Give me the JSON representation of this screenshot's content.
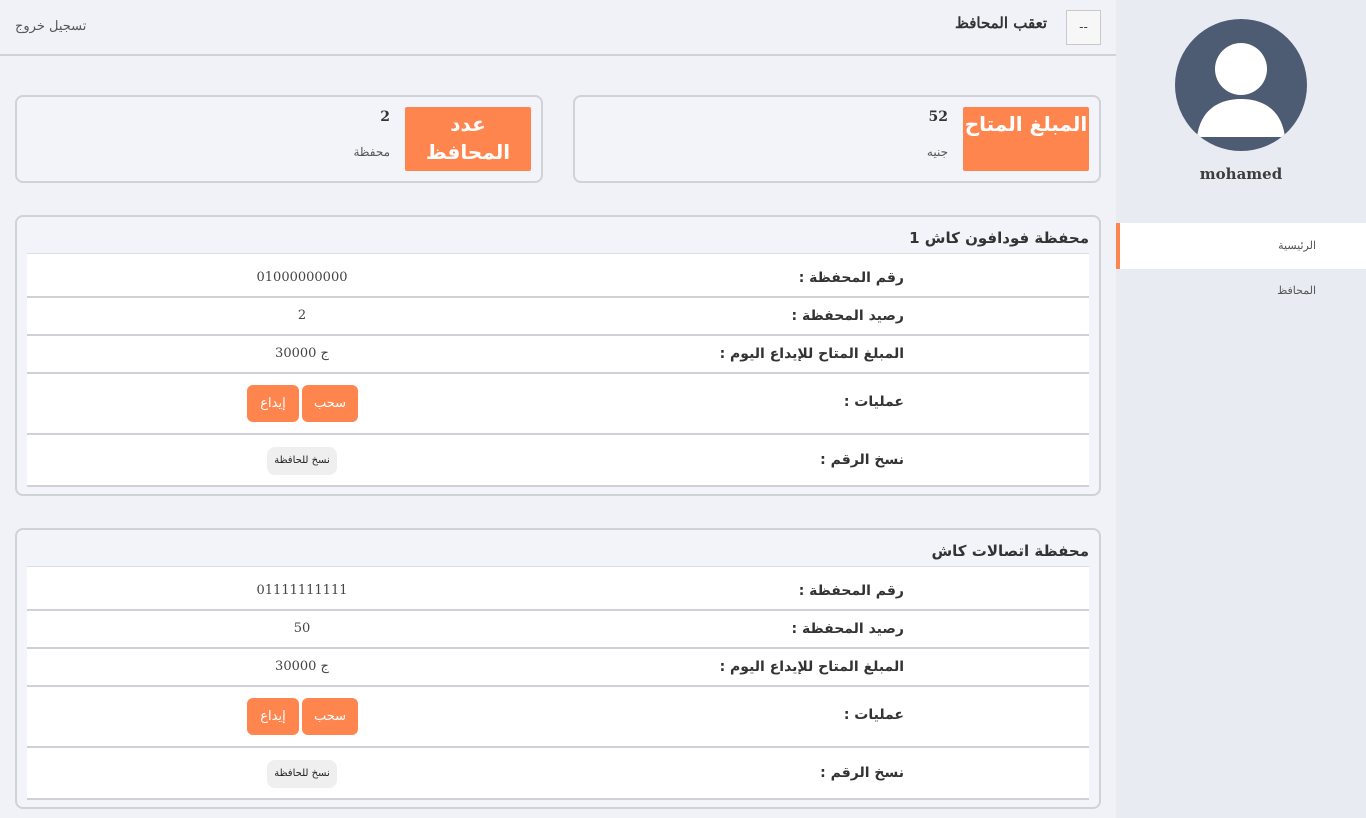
{
  "header": {
    "menu_label": "--",
    "title": "تعقب المحافظ",
    "logout_label": "تسجيل خروج"
  },
  "sidebar": {
    "username": "mohamed",
    "items": [
      {
        "label": "الرئيسية",
        "active": true
      },
      {
        "label": "المحافظ",
        "active": false
      }
    ]
  },
  "stats": {
    "available": {
      "title": "المبلغ المتاح",
      "value": "52",
      "unit": "جنيه"
    },
    "wallets": {
      "title": "عدد المحافظ",
      "value": "2",
      "unit": "محفظة"
    }
  },
  "labels": {
    "wallet_number": "رقم المحفظة :",
    "wallet_balance": "رصيد المحفظة :",
    "daily_limit": "المبلغ المتاح للإيداع اليوم :",
    "operations": "عمليات :",
    "copy_number": "نسخ الرقم :",
    "withdraw": "سحب",
    "deposit": "إيداع",
    "copy_button": "نسخ للحافظة"
  },
  "wallets": [
    {
      "title": "محفظة فودافون كاش 1",
      "number": "01000000000",
      "balance": "2",
      "daily_limit": "30000 ج"
    },
    {
      "title": "محفظة اتصالات كاش",
      "number": "01111111111",
      "balance": "50",
      "daily_limit": "30000 ج"
    }
  ],
  "colors": {
    "accent": "#ff854f",
    "avatar": "#4d5b73",
    "background": "#f1f2f8",
    "sidebar": "#e9ebf3"
  }
}
